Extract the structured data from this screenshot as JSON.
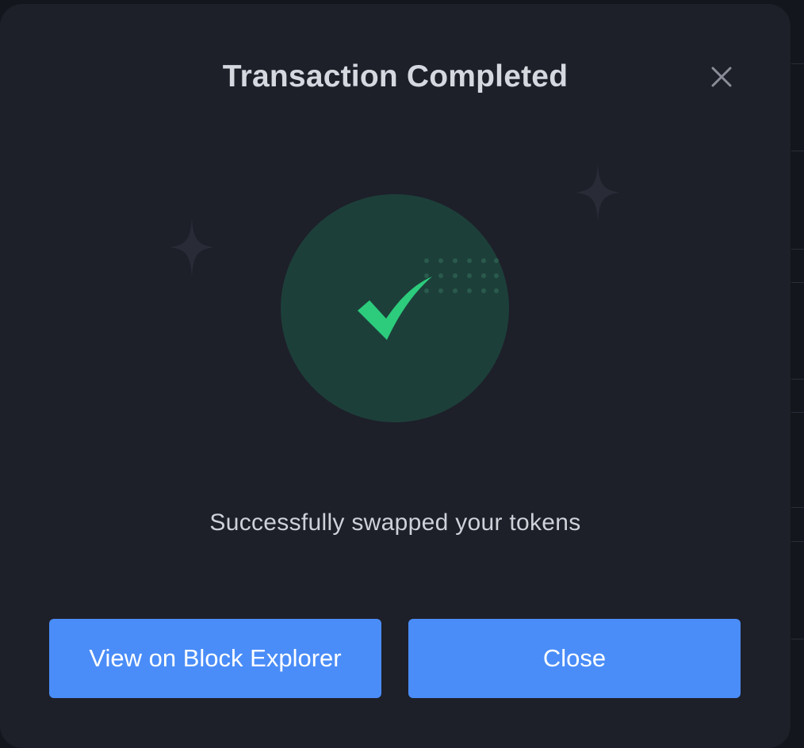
{
  "modal": {
    "title": "Transaction Completed",
    "message": "Successfully swapped your tokens",
    "close_icon": "close-icon",
    "status_icon": "checkmark-icon",
    "buttons": {
      "explorer_label": "View on Block Explorer",
      "close_label": "Close"
    }
  },
  "colors": {
    "modal_background": "#1d1f29",
    "button_background": "#4a8df8",
    "success_green": "#2ccc7c",
    "success_circle": "#1d3f3a"
  }
}
